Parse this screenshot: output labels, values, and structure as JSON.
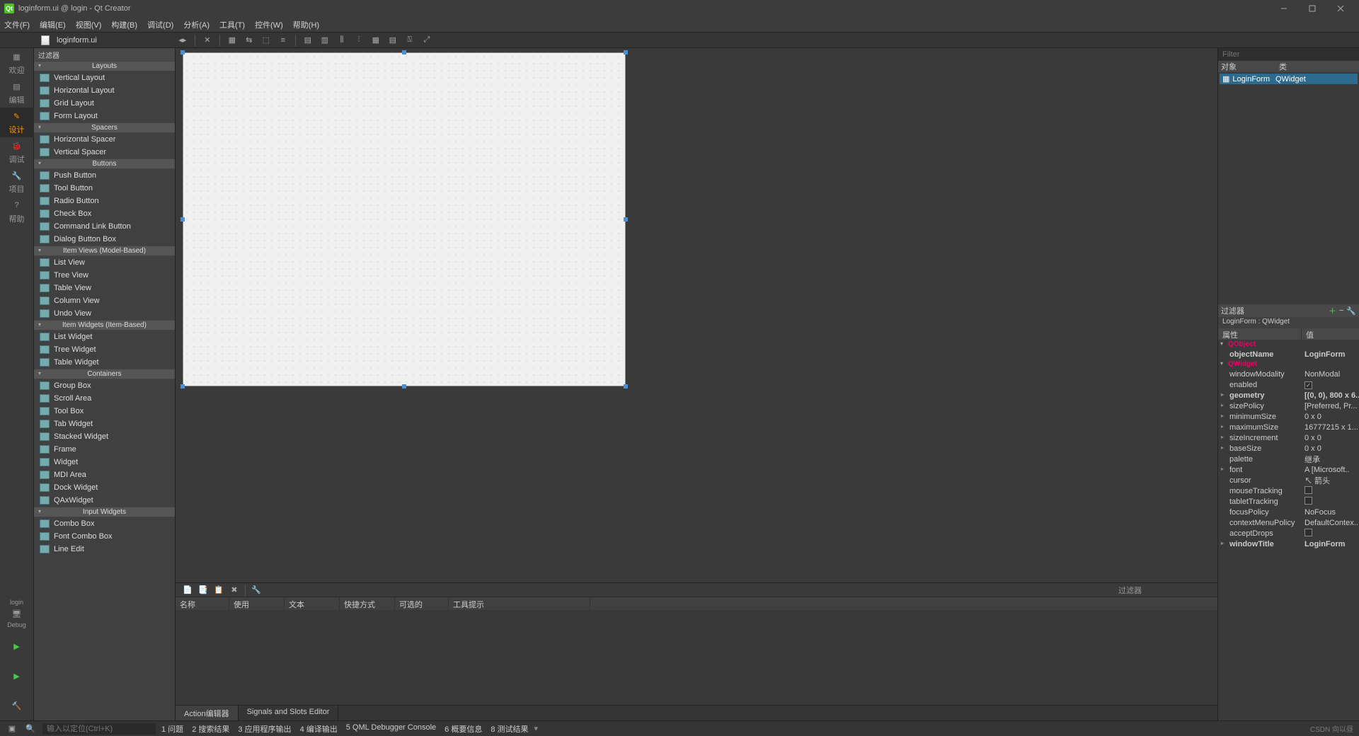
{
  "window": {
    "title": "loginform.ui @ login - Qt Creator"
  },
  "menu": [
    "文件(F)",
    "编辑(E)",
    "视图(V)",
    "构建(B)",
    "调试(D)",
    "分析(A)",
    "工具(T)",
    "控件(W)",
    "帮助(H)"
  ],
  "filetab": {
    "name": "loginform.ui"
  },
  "leftRail": {
    "items": [
      {
        "label": "欢迎",
        "icon": "grid"
      },
      {
        "label": "编辑",
        "icon": "edit"
      },
      {
        "label": "设计",
        "icon": "pencil",
        "active": true
      },
      {
        "label": "调试",
        "icon": "bug"
      },
      {
        "label": "项目",
        "icon": "wrench"
      },
      {
        "label": "帮助",
        "icon": "help"
      }
    ],
    "bottom": {
      "target": "login",
      "kit": "Debug"
    }
  },
  "widgetBox": {
    "filterHead": "过滤器",
    "groups": [
      {
        "cat": "Layouts",
        "items": [
          "Vertical Layout",
          "Horizontal Layout",
          "Grid Layout",
          "Form Layout"
        ]
      },
      {
        "cat": "Spacers",
        "items": [
          "Horizontal Spacer",
          "Vertical Spacer"
        ]
      },
      {
        "cat": "Buttons",
        "items": [
          "Push Button",
          "Tool Button",
          "Radio Button",
          "Check Box",
          "Command Link Button",
          "Dialog Button Box"
        ]
      },
      {
        "cat": "Item Views (Model-Based)",
        "items": [
          "List View",
          "Tree View",
          "Table View",
          "Column View",
          "Undo View"
        ]
      },
      {
        "cat": "Item Widgets (Item-Based)",
        "items": [
          "List Widget",
          "Tree Widget",
          "Table Widget"
        ]
      },
      {
        "cat": "Containers",
        "items": [
          "Group Box",
          "Scroll Area",
          "Tool Box",
          "Tab Widget",
          "Stacked Widget",
          "Frame",
          "Widget",
          "MDI Area",
          "Dock Widget",
          "QAxWidget"
        ]
      },
      {
        "cat": "Input Widgets",
        "items": [
          "Combo Box",
          "Font Combo Box",
          "Line Edit"
        ]
      }
    ]
  },
  "actionEditor": {
    "filterLabel": "过滤器",
    "columns": [
      "名称",
      "使用",
      "文本",
      "快捷方式",
      "可选的",
      "工具提示"
    ],
    "tabs": [
      "Action编辑器",
      "Signals and Slots Editor"
    ]
  },
  "objectInspector": {
    "filterPlaceholder": "Filter",
    "head": [
      "对象",
      "类"
    ],
    "row": {
      "name": "LoginForm",
      "cls": "QWidget"
    }
  },
  "propertyEditor": {
    "filterHead": "过滤器",
    "title": "LoginForm : QWidget",
    "head": [
      "属性",
      "值"
    ],
    "groups": [
      {
        "group": "QObject",
        "rows": [
          {
            "name": "objectName",
            "value": "LoginForm",
            "bold": true
          }
        ]
      },
      {
        "group": "QWidget",
        "rows": [
          {
            "name": "windowModality",
            "value": "NonModal"
          },
          {
            "name": "enabled",
            "value": "__check_on"
          },
          {
            "name": "geometry",
            "value": "[(0, 0), 800 x 6..",
            "bold": true,
            "exp": true
          },
          {
            "name": "sizePolicy",
            "value": "[Preferred, Pr...",
            "exp": true
          },
          {
            "name": "minimumSize",
            "value": "0 x 0",
            "exp": true
          },
          {
            "name": "maximumSize",
            "value": "16777215 x 1...",
            "exp": true
          },
          {
            "name": "sizeIncrement",
            "value": "0 x 0",
            "exp": true
          },
          {
            "name": "baseSize",
            "value": "0 x 0",
            "exp": true
          },
          {
            "name": "palette",
            "value": "继承"
          },
          {
            "name": "font",
            "value": "A  [Microsoft..",
            "exp": true
          },
          {
            "name": "cursor",
            "value": "↖ 箭头"
          },
          {
            "name": "mouseTracking",
            "value": "__check_off"
          },
          {
            "name": "tabletTracking",
            "value": "__check_off"
          },
          {
            "name": "focusPolicy",
            "value": "NoFocus"
          },
          {
            "name": "contextMenuPolicy",
            "value": "DefaultContex.."
          },
          {
            "name": "acceptDrops",
            "value": "__check_off"
          },
          {
            "name": "windowTitle",
            "value": "LoginForm",
            "bold": true,
            "exp": true
          }
        ]
      }
    ]
  },
  "statusBar": {
    "searchPlaceholder": "输入以定位(Ctrl+K)",
    "items": [
      "1  问题",
      "2  搜索结果",
      "3  应用程序输出",
      "4  编译输出",
      "5  QML Debugger Console",
      "6  概要信息",
      "8  测试结果"
    ],
    "watermark": "CSDN 向以昼"
  }
}
